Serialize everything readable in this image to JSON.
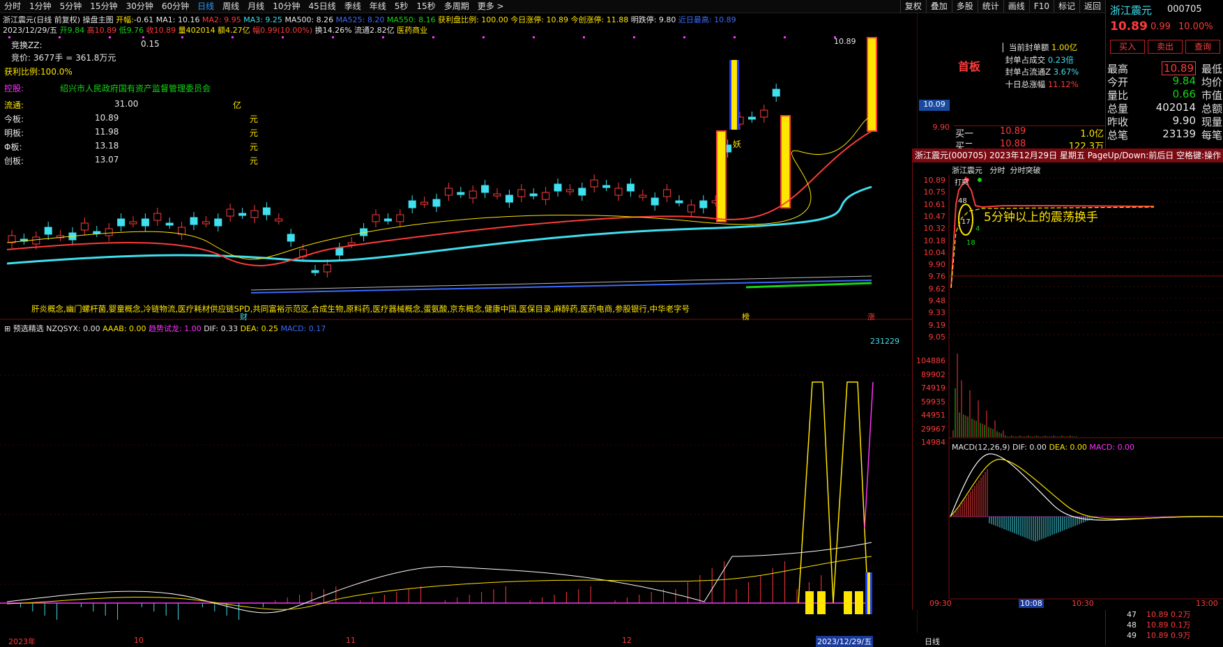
{
  "toolbar": {
    "periods": [
      "分时",
      "1分钟",
      "5分钟",
      "15分钟",
      "30分钟",
      "60分钟",
      "日线",
      "周线",
      "月线",
      "10分钟",
      "45日线",
      "季线",
      "年线",
      "5秒",
      "15秒",
      "多周期",
      "更多 >"
    ],
    "active_period": "日线",
    "right_buttons": [
      "复权",
      "叠加",
      "多股",
      "统计",
      "画线",
      "F10",
      "标记",
      "返回"
    ]
  },
  "chart_header": {
    "title": "浙江震元(日线 前复权)",
    "indicator": "操盘主图",
    "open_label": "开幅:",
    "open_val": "-0.61",
    "ma1": "MA1: 10.16",
    "ma2": "MA2: 9.95",
    "ma3": "MA3: 9.25",
    "ma500": "MA500: 8.26",
    "ma525": "MA525: 8.20",
    "ma550": "MA550: 8.16",
    "profit_ratio": "获利盘比例: 100.00",
    "today_limit": "今日涨停: 10.89",
    "tomorrow_limit": "今创涨停: 11.88",
    "next_limit": "明跌停: 9.80",
    "near_high": "近日最高: 10.89",
    "date": "2023/12/29/五",
    "ohlc": [
      "开9.84",
      "高10.89",
      "低9.76",
      "收10.89",
      "量402014",
      "额4.27亿",
      "幅0.99(10.00%)",
      "换14.26%",
      "流通2.82亿",
      "医药商业"
    ]
  },
  "info_box": {
    "bid_zz_label": "竞换ZZ:",
    "bid_zz_val": "0.15",
    "auction": "竞价:  3677手 = 361.8万元",
    "profit_ratio": "获利比例:100.0%",
    "holder_label": "控股:",
    "holder": "绍兴市人民政府国有资产监督管理委员会",
    "float_label": "流通:",
    "float_val": "31.00",
    "float_unit": "亿",
    "rows": [
      {
        "label": "今板:",
        "val": "10.89",
        "unit": "元"
      },
      {
        "label": "明板:",
        "val": "11.98",
        "unit": "元"
      },
      {
        "label": "Φ板:",
        "val": "13.18",
        "unit": "元"
      },
      {
        "label": "创板:",
        "val": "13.07",
        "unit": "元"
      }
    ]
  },
  "concepts": "肝炎概念,幽门螺杆菌,婴童概念,冷链物流,医疗耗材供应链SPD,共同富裕示范区,合成生物,原料药,医疗器械概念,蛋氨酸,京东概念,健康中国,医保目录,麻醉药,医药电商,参股银行,中华老字号",
  "chart_marks": {
    "cai": "财",
    "bang": "榜",
    "zhang": "涨",
    "yao": "妖",
    "high_label": "10.89"
  },
  "lower_header": {
    "name": "预选精选",
    "nzqsyx": "NZQSYX: 0.00",
    "aaab": "AAAB: 0.00",
    "qushi": "趋势试龙: 1.00",
    "dif": "DIF: 0.33",
    "dea": "DEA: 0.25",
    "macd": "MACD: 0.17",
    "vol_label": "231229"
  },
  "x_axis": {
    "labels": [
      "2023年",
      "10",
      "11",
      "12",
      "2023/12/29/五"
    ],
    "tail": "日线"
  },
  "y_axis_main": [
    "10.09",
    "9.90"
  ],
  "seal": {
    "title": "首板",
    "rows": [
      {
        "label": "当前封单额",
        "val": "1.00亿",
        "color": "#ffe600"
      },
      {
        "label": "封单占成交",
        "val": "0.23倍",
        "color": "#3fe0f0"
      },
      {
        "label": "封单占流通Z",
        "val": "3.67%",
        "color": "#3fe0f0"
      },
      {
        "label": "十日总涨幅",
        "val": "11.12%",
        "color": "#ff3b3b"
      }
    ]
  },
  "order_book": [
    {
      "label": "买一",
      "price": "10.89",
      "vol": "1.0亿"
    },
    {
      "label": "买二",
      "price": "10.88",
      "vol": "122.3万"
    }
  ],
  "intraday": {
    "title": "浙江震元(000705) 2023年12月29日 星期五 PageUp/Down:前后日 空格键:操作",
    "tabs": [
      "浙江震元",
      "分时",
      "分时突破"
    ],
    "price_ticks": [
      "10.89",
      "10.75",
      "10.61",
      "10.47",
      "10.32",
      "10.18",
      "10.04",
      "9.90",
      "9.76",
      "9.62",
      "9.48",
      "9.33",
      "9.19",
      "9.05"
    ],
    "vol_ticks": [
      "104886",
      "89902",
      "74919",
      "59935",
      "44951",
      "29967",
      "14984"
    ],
    "macd": {
      "name": "MACD(12,26,9)",
      "dif": "DIF: 0.00",
      "dea": "DEA: 0.00",
      "macd": "MACD: 0.00"
    },
    "time_labels": [
      "09:30",
      "10:08",
      "10:30",
      "13:00"
    ],
    "annotation": "5分钟以上的震荡换手",
    "marks": [
      "48",
      "17",
      "4",
      "18"
    ],
    "tag": "打突"
  },
  "quote": {
    "name": "浙江震元",
    "code": "000705",
    "price": "10.89",
    "change": "0.99",
    "pct": "10.00%",
    "buy": "买入",
    "sell": "卖出",
    "query": "查询",
    "rows": [
      {
        "l": "最高",
        "v": "10.89",
        "r": "最低",
        "boxed": true
      },
      {
        "l": "今开",
        "v": "9.84",
        "r": "均价",
        "color": "#16d616"
      },
      {
        "l": "量比",
        "v": "0.66",
        "r": "市值",
        "color": "#16d616"
      },
      {
        "l": "总量",
        "v": "402014",
        "r": "总额",
        "color": "#e0e0e0"
      },
      {
        "l": "昨收",
        "v": "9.90",
        "r": "现量",
        "color": "#e0e0e0"
      },
      {
        "l": "总笔",
        "v": "23139",
        "r": "每笔",
        "color": "#e0e0e0"
      }
    ],
    "trades": [
      {
        "n": "47",
        "p": "10.89",
        "v": "0.2万"
      },
      {
        "n": "48",
        "p": "10.89",
        "v": "0.1万"
      },
      {
        "n": "49",
        "p": "10.89",
        "v": "0.9万"
      }
    ]
  },
  "colors": {
    "up": "#ff3b3b",
    "down": "#3fe0f0",
    "grid": "#7a1010",
    "accent": "#ffe600"
  }
}
